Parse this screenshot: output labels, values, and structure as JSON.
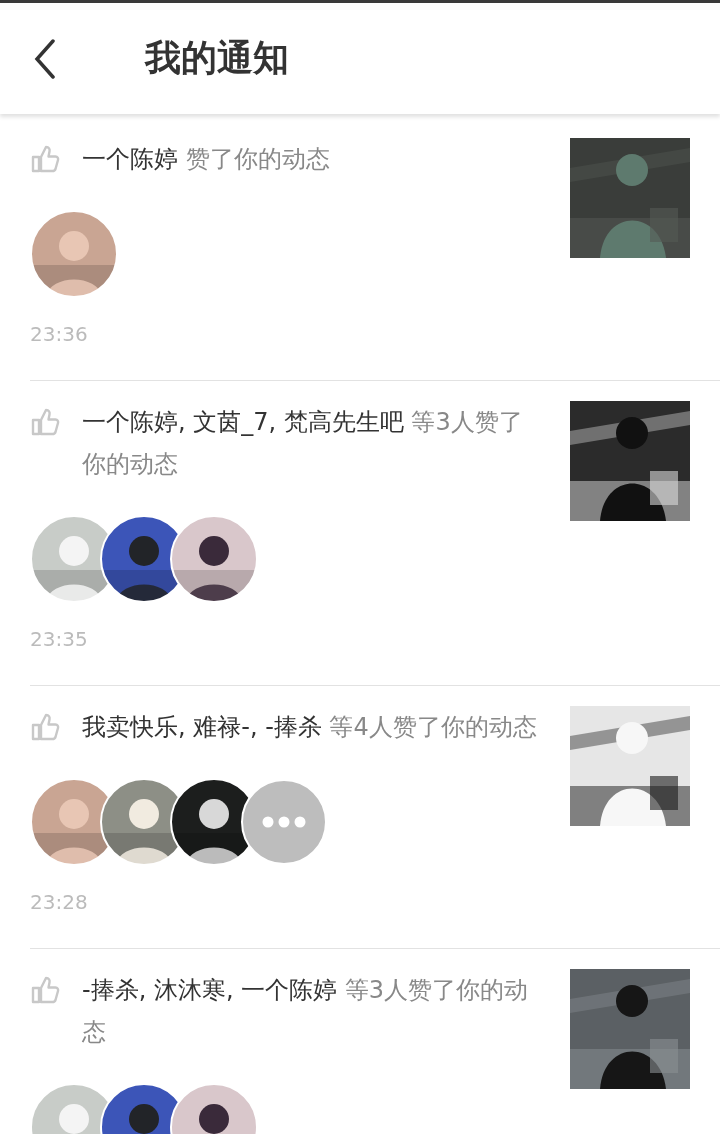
{
  "header": {
    "title": "我的通知"
  },
  "notifications": [
    {
      "names": "一个陈婷",
      "action": "赞了你的动态",
      "avatars": [
        {
          "kind": "picture"
        }
      ],
      "time": "23:36",
      "thumbnail": {
        "kind": "picture"
      }
    },
    {
      "names": "一个陈婷, 文茵_7, 梵高先生吧",
      "action": "等3人赞了你的动态",
      "avatars": [
        {
          "kind": "picture"
        },
        {
          "kind": "picture"
        },
        {
          "kind": "picture"
        }
      ],
      "time": "23:35",
      "thumbnail": {
        "kind": "picture"
      }
    },
    {
      "names": "我卖快乐, 难禄-, -捧杀",
      "action": "等4人赞了你的动态",
      "avatars": [
        {
          "kind": "picture"
        },
        {
          "kind": "picture"
        },
        {
          "kind": "picture"
        },
        {
          "kind": "more"
        }
      ],
      "time": "23:28",
      "thumbnail": {
        "kind": "picture"
      }
    },
    {
      "names": "-捧杀, 沐沐寒, 一个陈婷",
      "action": "等3人赞了你的动态",
      "avatars": [
        {
          "kind": "picture"
        },
        {
          "kind": "picture"
        },
        {
          "kind": "picture"
        }
      ],
      "thumbnail": {
        "kind": "picture"
      }
    }
  ]
}
